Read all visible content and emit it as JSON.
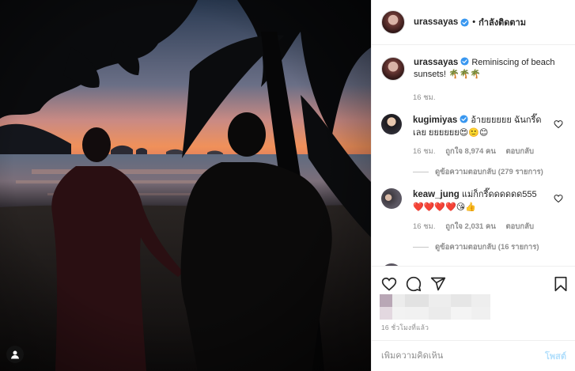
{
  "post": {
    "owner": {
      "username": "urassayas",
      "verified": true,
      "follow_status": "กำลังติดตาม",
      "separator": "•"
    },
    "caption": {
      "username": "urassayas",
      "text": "Reminiscing of beach sunsets! 🌴🌴🌴",
      "time": "16 ชม."
    },
    "comments": [
      {
        "username": "kugimiyas",
        "verified": true,
        "text": "อ้ายยยยยย ฉันกรี๊ดเลย ยยยยยย😍🙂😊",
        "time": "16 ชม.",
        "likes": "ถูกใจ 8,974 คน",
        "reply_label": "ตอบกลับ",
        "view_replies": "ดูข้อความตอบกลับ (279 รายการ)"
      },
      {
        "username": "keaw_jung",
        "verified": false,
        "text": "แม่ก็กรี๊ดดดดดด555 ❤️❤️❤️❤️😘👍",
        "time": "16 ชม.",
        "likes": "ถูกใจ 2,031 คน",
        "reply_label": "ตอบกลับ",
        "view_replies": "ดูข้อความตอบกลับ (16 รายการ)"
      }
    ],
    "posted_ago": "16 ชั่วโมงที่แล้ว",
    "composer": {
      "placeholder": "เพิ่มความคิดเห็น",
      "post_label": "โพสต์"
    }
  },
  "icons": {
    "like": "heart-icon",
    "comment": "comment-icon",
    "share": "paper-plane-icon",
    "save": "bookmark-icon",
    "tag": "person-tag-icon",
    "verified": "verified-badge-icon"
  },
  "colors": {
    "verified_blue": "#3897f0",
    "post_button_disabled": "#b2dffc",
    "secondary_text": "#8e8e8e",
    "border": "#efefef"
  }
}
